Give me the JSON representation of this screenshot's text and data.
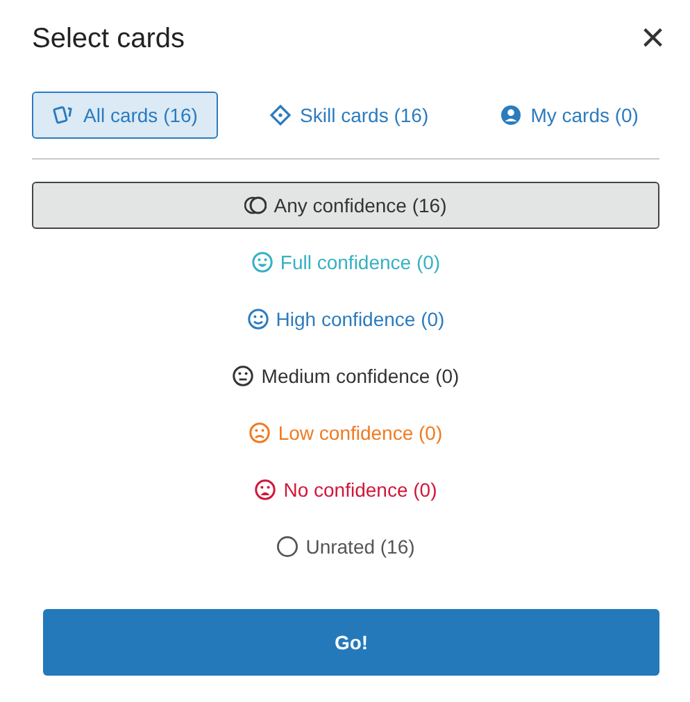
{
  "dialog": {
    "title": "Select cards",
    "close": "×"
  },
  "tabs": [
    {
      "label": "All cards (16)",
      "kind": "cards",
      "selected": true
    },
    {
      "label": "Skill cards (16)",
      "kind": "diamond",
      "selected": false
    },
    {
      "label": "My cards (0)",
      "kind": "user",
      "selected": false
    }
  ],
  "confidence": [
    {
      "label": "Any confidence (16)",
      "kind": "any",
      "color": "#333333",
      "selected": true
    },
    {
      "label": "Full confidence (0)",
      "kind": "full",
      "color": "#36b0c4",
      "selected": false
    },
    {
      "label": "High confidence (0)",
      "kind": "high",
      "color": "#2b7bbf",
      "selected": false
    },
    {
      "label": "Medium confidence (0)",
      "kind": "medium",
      "color": "#333333",
      "selected": false
    },
    {
      "label": "Low confidence (0)",
      "kind": "low",
      "color": "#f07a22",
      "selected": false
    },
    {
      "label": "No confidence (0)",
      "kind": "none",
      "color": "#d0163a",
      "selected": false
    },
    {
      "label": "Unrated (16)",
      "kind": "unrated",
      "color": "#555555",
      "selected": false
    }
  ],
  "go_button": "Go!"
}
